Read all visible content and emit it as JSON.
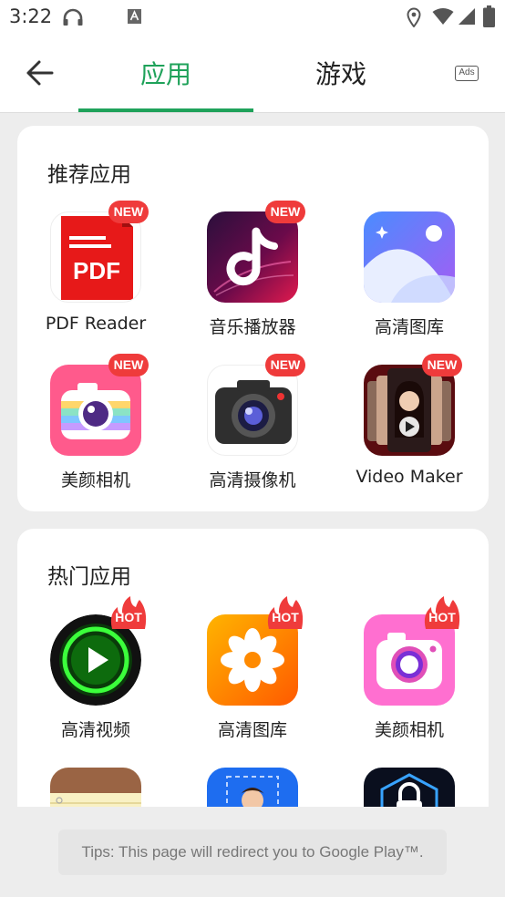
{
  "status_bar": {
    "time": "3:22",
    "icons": [
      "headset-icon",
      "app-a-icon",
      "location-icon",
      "wifi-icon",
      "signal-icon",
      "battery-icon"
    ]
  },
  "header": {
    "back_icon": "arrow-left-icon",
    "tabs": [
      {
        "label": "应用",
        "active": true
      },
      {
        "label": "游戏",
        "active": false
      }
    ],
    "ads_label": "Ads",
    "accent_color": "#1fa25a"
  },
  "recommended": {
    "title": "推荐应用",
    "apps": [
      {
        "label": "PDF Reader",
        "badge": "NEW"
      },
      {
        "label": "音乐播放器",
        "badge": "NEW"
      },
      {
        "label": "高清图库",
        "badge": ""
      },
      {
        "label": "美颜相机",
        "badge": "NEW"
      },
      {
        "label": "高清摄像机",
        "badge": "NEW"
      },
      {
        "label": "Video Maker",
        "badge": "NEW"
      }
    ],
    "pdf_icon_text": "PDF"
  },
  "popular": {
    "title": "热门应用",
    "apps": [
      {
        "label": "高清视频",
        "badge": "HOT"
      },
      {
        "label": "高清图库",
        "badge": "HOT"
      },
      {
        "label": "美颜相机",
        "badge": "HOT"
      }
    ]
  },
  "footer": {
    "tip": "Tips: This page will redirect you to Google Play™."
  }
}
